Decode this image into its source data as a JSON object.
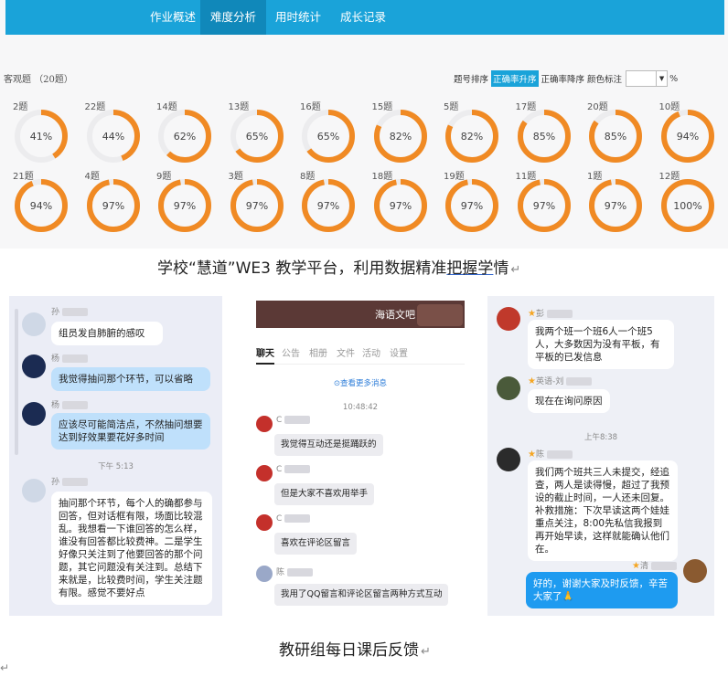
{
  "nav": {
    "tabs": [
      {
        "label": "作业概述",
        "active": false
      },
      {
        "label": "难度分析",
        "active": true
      },
      {
        "label": "用时统计",
        "active": false
      },
      {
        "label": "成长记录",
        "active": false
      }
    ]
  },
  "dashboard": {
    "section_label": "客观题 （20题）",
    "sort_label": "题号排序",
    "sort_active": "正确率升序",
    "sort_desc": "正确率降序",
    "color_label": "颜色标注",
    "color_value": "",
    "pct_sign": "%",
    "arrow": "▼",
    "ring_color": "#f08a24",
    "ring_track": "#ececee",
    "rows": [
      [
        {
          "q": "2题",
          "pct": 41
        },
        {
          "q": "22题",
          "pct": 44
        },
        {
          "q": "14题",
          "pct": 62
        },
        {
          "q": "13题",
          "pct": 65
        },
        {
          "q": "16题",
          "pct": 65
        },
        {
          "q": "15题",
          "pct": 82
        },
        {
          "q": "5题",
          "pct": 82
        },
        {
          "q": "17题",
          "pct": 85
        },
        {
          "q": "20题",
          "pct": 85
        },
        {
          "q": "10题",
          "pct": 94
        }
      ],
      [
        {
          "q": "21题",
          "pct": 94
        },
        {
          "q": "4题",
          "pct": 97
        },
        {
          "q": "9题",
          "pct": 97
        },
        {
          "q": "3题",
          "pct": 97
        },
        {
          "q": "8题",
          "pct": 97
        },
        {
          "q": "18题",
          "pct": 97
        },
        {
          "q": "19题",
          "pct": 97
        },
        {
          "q": "11题",
          "pct": 97
        },
        {
          "q": "1题",
          "pct": 97
        },
        {
          "q": "12题",
          "pct": 100
        }
      ]
    ]
  },
  "captions": {
    "top_pre": "学校“慧道”WE3 教学平台，利用数据精准",
    "top_underlined": "把握学",
    "top_post": "情",
    "return_mark": "↵",
    "bottom": "教研组每日课后反馈"
  },
  "left_chat": {
    "msgs": [
      {
        "name": "孙",
        "text": "组员发自肺腑的感叹"
      },
      {
        "name": "杨",
        "text": "我觉得抽问那个环节，可以省略"
      },
      {
        "name": "杨",
        "text": "应该尽可能简洁点，不然抽问想要达到好效果要花好多时间"
      },
      {
        "name": "孙",
        "text": "抽问那个环节，每个人的确都参与回答，但对话框有限，场面比较混乱。我想看一下谁回答的怎么样，谁没有回答都比较费神。二是学生好像只关注到了他要回答的那个问题，其它问题没有关注到。总结下来就是，比较费时间，学生关注题有限。感觉不要好点"
      }
    ],
    "time": "下午 5:13"
  },
  "mid_chat": {
    "title": "海语文吧",
    "tabs": [
      "聊天",
      "公告",
      "相册",
      "文件",
      "活动",
      "设置"
    ],
    "more": "查看更多消息",
    "time": "10:48:42",
    "msgs": [
      {
        "name": "C",
        "text": "我觉得互动还是挺踊跃的"
      },
      {
        "name": "C",
        "text": "但是大家不喜欢用举手"
      },
      {
        "name": "C",
        "text": "喜欢在评论区留言"
      },
      {
        "name": "陈",
        "text": "我用了QQ留言和评论区留言两种方式互动"
      }
    ]
  },
  "right_chat": {
    "msgs": [
      {
        "name": "彭",
        "text": "我两个班一个班6人一个班5人，大多数因为没有平板，有平板的已发信息"
      },
      {
        "name": "英语-刘",
        "text": "现在在询问原因"
      },
      {
        "name": "陈",
        "text": "我们两个班共三人未提交，经追查，两人是读得慢，超过了我预设的截止时间，一人还未回复。补救措施：下次早读这两个娃娃重点关注，8:00先私信我报到再开始早读，这样就能确认他们在。"
      },
      {
        "name": "清",
        "text": "好的，谢谢大家及时反馈，辛苦大家了🙏"
      }
    ],
    "time": "上午8:38"
  }
}
